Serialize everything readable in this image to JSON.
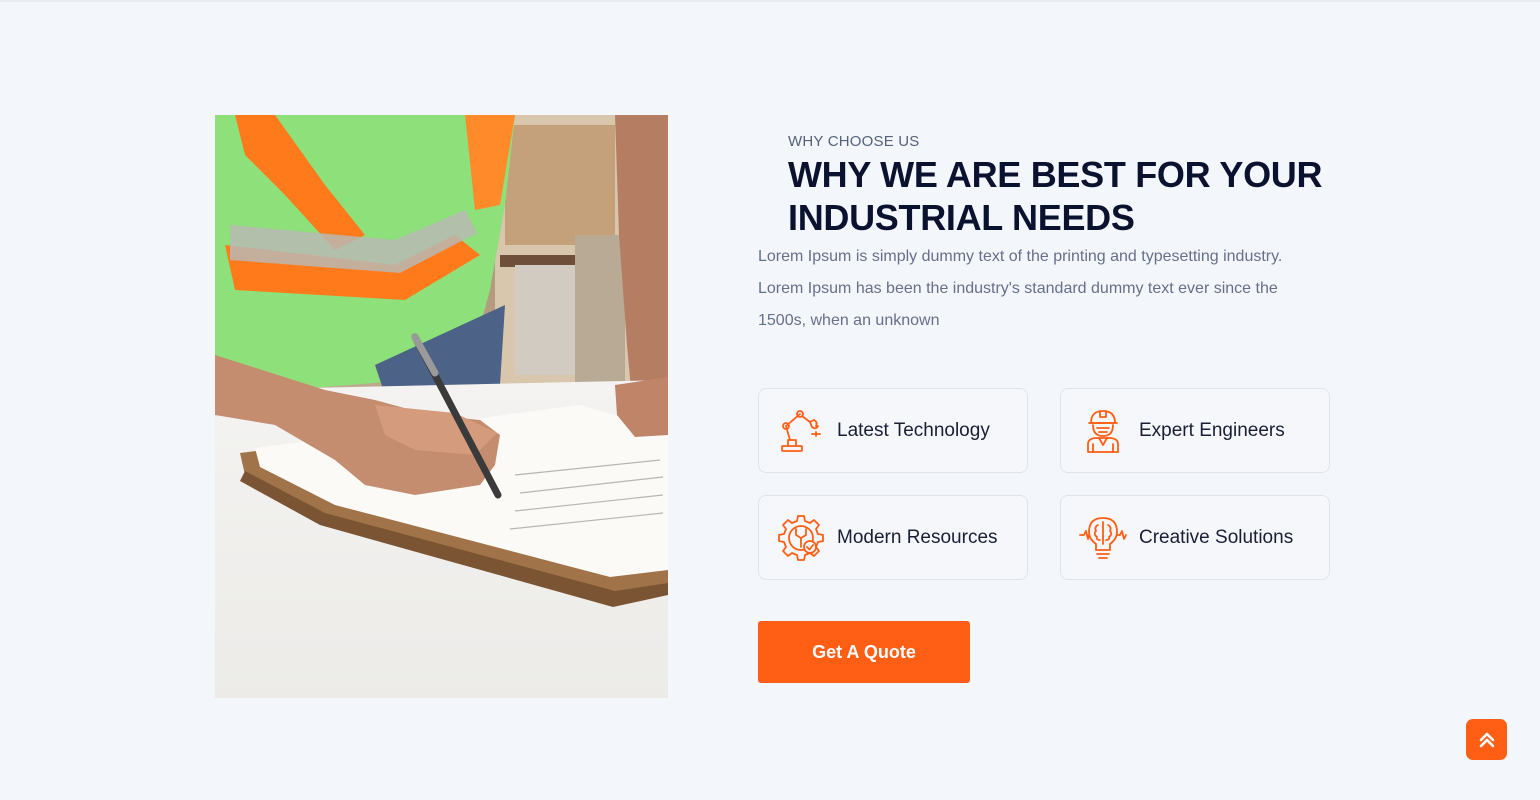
{
  "section": {
    "eyebrow": "WHY CHOOSE US",
    "title_line1": "WHY WE ARE BEST FOR YOUR",
    "title_line2": "INDUSTRIAL NEEDS",
    "description": "Lorem Ipsum is simply dummy text of the printing and typesetting industry. Lorem Ipsum has been the industry's standard dummy text ever since the 1500s, when an unknown"
  },
  "features": [
    {
      "label": "Latest Technology",
      "icon": "robotic-arm-icon"
    },
    {
      "label": "Expert Engineers",
      "icon": "engineer-helmet-icon"
    },
    {
      "label": "Modern Resources",
      "icon": "gear-wrench-icon"
    },
    {
      "label": "Creative Solutions",
      "icon": "lightbulb-brain-icon"
    }
  ],
  "cta": {
    "label": "Get A Quote"
  },
  "back_to_top": {
    "icon": "double-chevron-up-icon"
  },
  "colors": {
    "accent": "#ff5e14",
    "heading": "#0b1230",
    "body_text": "#66708a",
    "background": "#f3f6fb",
    "card_border": "#dfe4ec"
  },
  "image": {
    "subject": "worker-in-safety-vest-writing-on-clipboard-photo"
  }
}
